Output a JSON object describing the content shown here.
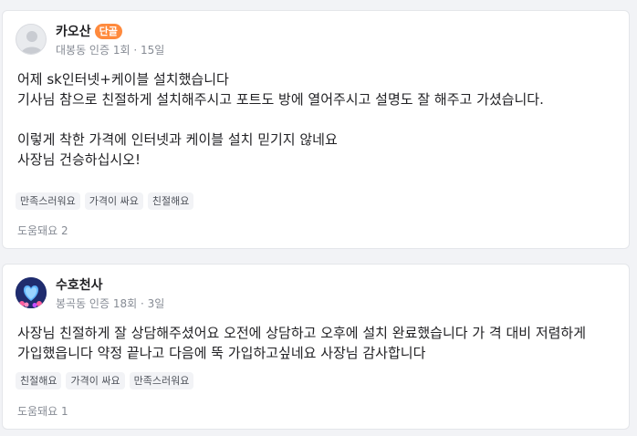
{
  "reviews": [
    {
      "author": "카오산",
      "badge": "단골",
      "meta": "대봉동 인증 1회 · 15일",
      "body": "어제 sk인터넷+케이블 설치했습니다\n기사님 참으로 친절하게 설치해주시고 포트도 방에 열어주시고 설명도 잘 해주고 가셨습니다.\n\n이렇게 착한 가격에 인터넷과 케이블 설치 믿기지 않네요\n사장님 건승하십시오!",
      "tags": [
        "만족스러워요",
        "가격이 싸요",
        "친절해요"
      ],
      "helpful": "도움돼요 2"
    },
    {
      "author": "수호천사",
      "meta": "봉곡동 인증 18회 · 3일",
      "body": "사장님 친절하게 잘 상담해주셨어요 오전에 상담하고 오후에 설치 완료했습니다 가 격 대비 저렴하게 가입했읍니다 약정 끝나고 다음에 뚝 가입하고싶네요 사장님 감사합니다",
      "tags": [
        "친절해요",
        "가격이 싸요",
        "만족스러워요"
      ],
      "helpful": "도움돼요 1"
    }
  ]
}
